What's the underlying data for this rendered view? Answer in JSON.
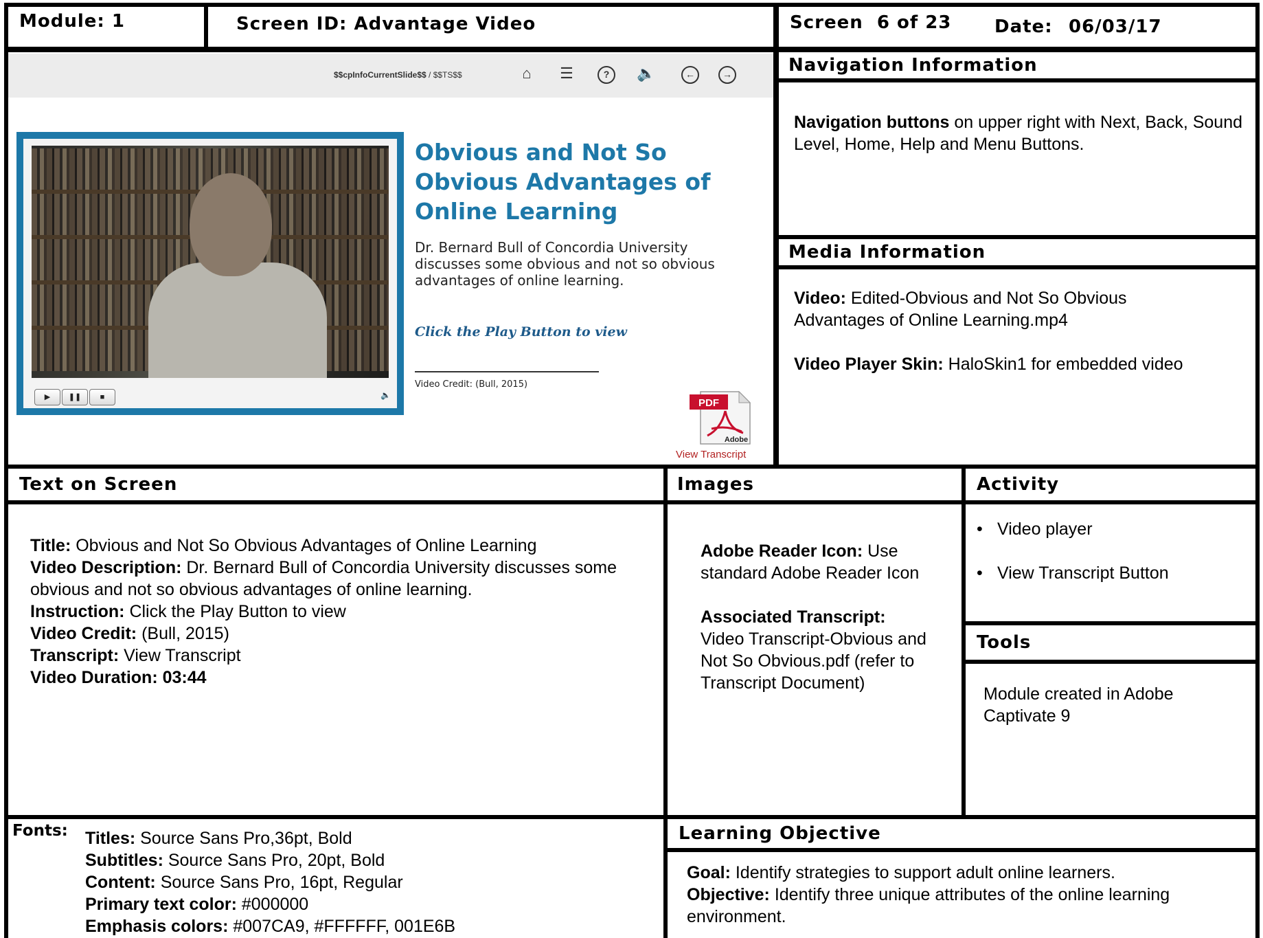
{
  "header": {
    "module": "Module: 1",
    "screen_id": "Screen ID: Advantage Video",
    "screen_count": "Screen  6 of 23",
    "date_label": "Date:",
    "date_value": "06/03/17"
  },
  "slide": {
    "toolbar": {
      "slide_var": "$$cpInfoCurrentSlide$$",
      "slide_sep": " / $$TS$$"
    },
    "title": "Obvious and Not So Obvious Advantages of Online Learning",
    "description": "Dr. Bernard Bull of Concordia University discusses some obvious and not so obvious advantages of online learning.",
    "instruction": "Click the Play Button to view",
    "credit": "Video Credit: (Bull, 2015)",
    "pdf_badge": "PDF",
    "pdf_brand": "Adobe",
    "view_transcript": "View Transcript",
    "player_controls": {
      "play": "▶",
      "pause": "❚❚",
      "stop": "■",
      "volume": "🔈"
    }
  },
  "navigation": {
    "heading": "Navigation Information",
    "bold": "Navigation buttons",
    "text": " on upper right with Next, Back, Sound Level, Home, Help and Menu Buttons."
  },
  "media": {
    "heading": "Media Information",
    "video_label": "Video:",
    "video_text": " Edited-Obvious and Not So Obvious Advantages of Online Learning.mp4",
    "skin_label": "Video Player Skin:",
    "skin_text": " HaloSkin1 for embedded video"
  },
  "text_on_screen": {
    "heading": "Text on Screen",
    "title_label": "Title:",
    "title_text": " Obvious and Not So Obvious Advantages of Online Learning",
    "desc_label": "Video Description:",
    "desc_text": " Dr. Bernard Bull of Concordia University discusses some obvious and not so obvious advantages of online learning.",
    "instr_label": "Instruction:",
    "instr_text": " Click the Play Button to view",
    "credit_label": "Video Credit:",
    "credit_text": " (Bull, 2015)",
    "transcript_label": "Transcript:",
    "transcript_text": " View Transcript",
    "duration_label": "Video Duration: 03:44"
  },
  "images": {
    "heading": "Images",
    "icon_label": "Adobe Reader Icon:",
    "icon_text": " Use standard Adobe Reader Icon",
    "assoc_label": "Associated Transcript:",
    "assoc_text": "Video Transcript-Obvious and Not So Obvious.pdf (refer to Transcript Document)"
  },
  "activity": {
    "heading": "Activity",
    "items": [
      "Video player",
      "View Transcript Button"
    ]
  },
  "tools": {
    "heading": "Tools",
    "text": "Module created in Adobe Captivate 9"
  },
  "fonts": {
    "heading": "Fonts:",
    "titles_label": "Titles:",
    "titles_text": " Source Sans Pro,36pt, Bold",
    "subtitles_label": "Subtitles:",
    "subtitles_text": " Source Sans Pro, 20pt, Bold",
    "content_label": "Content:",
    "content_text": " Source Sans Pro, 16pt, Regular",
    "primary_label": "Primary text color:",
    "primary_text": " #000000",
    "emphasis_label": "Emphasis colors:",
    "emphasis_text": " #007CA9, #FFFFFF, 001E6B"
  },
  "learning_objective": {
    "heading": "Learning Objective",
    "goal_label": "Goal:",
    "goal_text": " Identify strategies to support adult online learners.",
    "objective_label": "Objective:",
    "objective_text": " Identify three unique attributes of the online learning environment."
  },
  "colors": {
    "accent_blue": "#1d78a8",
    "border": "#000000",
    "transcript_red": "#b22222"
  }
}
